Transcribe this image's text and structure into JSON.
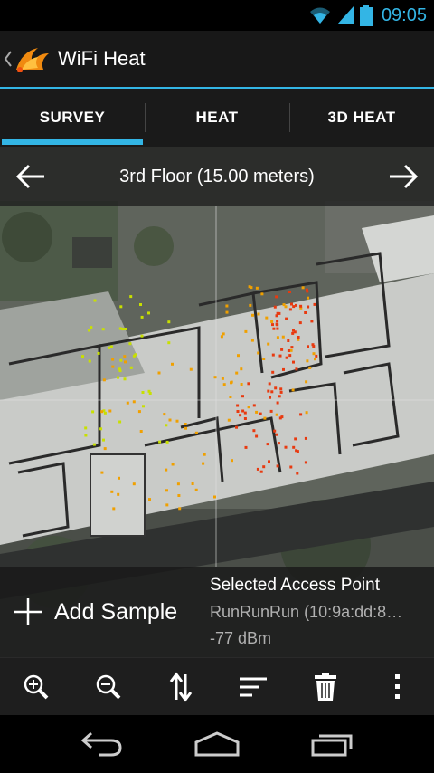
{
  "status_bar": {
    "time": "09:05",
    "icons": [
      "wifi-icon",
      "signal-icon",
      "battery-icon"
    ],
    "accent_color": "#33b5e5"
  },
  "app": {
    "title": "WiFi Heat",
    "logo_icon": "wifi-flame-logo-icon"
  },
  "tabs": [
    {
      "label": "SURVEY",
      "active": true
    },
    {
      "label": "HEAT",
      "active": false
    },
    {
      "label": "3D HEAT",
      "active": false
    }
  ],
  "floor": {
    "label": "3rd Floor (15.00 meters)",
    "prev_icon": "arrow-left-icon",
    "next_icon": "arrow-right-icon"
  },
  "sample": {
    "add_label": "Add Sample",
    "add_icon": "plus-icon"
  },
  "access_point": {
    "title": "Selected Access Point",
    "name": "RunRunRun (10:9a:dd:8…",
    "signal": "-77 dBm"
  },
  "toolbar": {
    "icons": [
      "zoom-in-icon",
      "zoom-out-icon",
      "sort-arrows-icon",
      "sort-lines-icon",
      "trash-icon",
      "overflow-menu-icon"
    ]
  },
  "navbar": {
    "icons": [
      "back-icon",
      "home-icon",
      "recent-apps-icon"
    ]
  },
  "heatmap_colors": {
    "strong": "#c8e000",
    "medium": "#f0a000",
    "weak": "#e83a10"
  }
}
